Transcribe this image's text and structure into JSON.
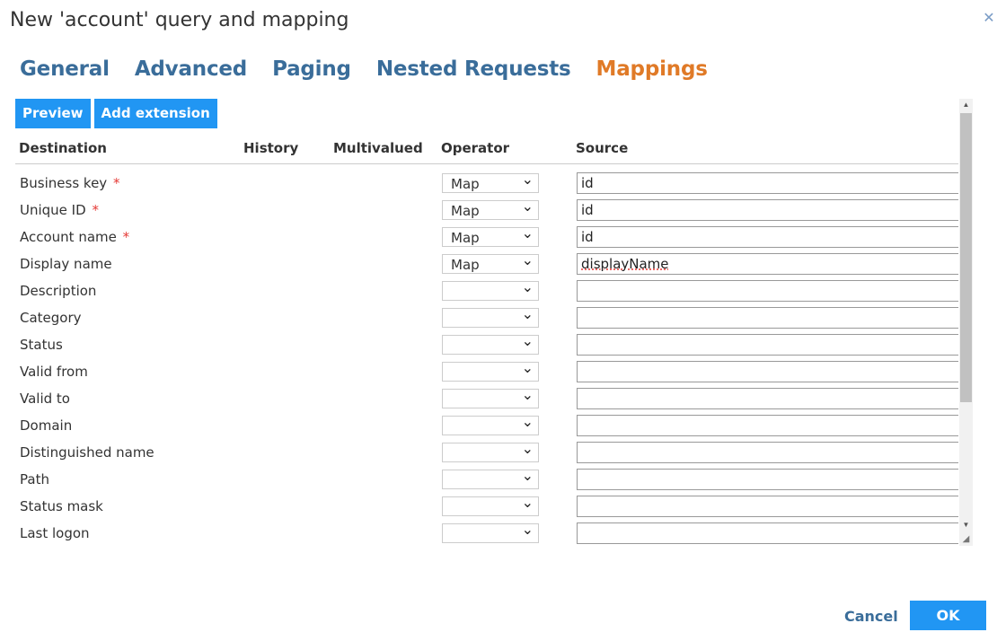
{
  "dialog": {
    "title": "New 'account' query and mapping",
    "close_icon": "close-icon"
  },
  "tabs": [
    {
      "label": "General",
      "active": false
    },
    {
      "label": "Advanced",
      "active": false
    },
    {
      "label": "Paging",
      "active": false
    },
    {
      "label": "Nested Requests",
      "active": false
    },
    {
      "label": "Mappings",
      "active": true
    }
  ],
  "toolbar": {
    "preview_label": "Preview",
    "add_extension_label": "Add extension"
  },
  "columns": {
    "destination": "Destination",
    "history": "History",
    "multivalued": "Multivalued",
    "operator": "Operator",
    "source": "Source"
  },
  "rows": [
    {
      "label": "Business key",
      "required": "*",
      "operator": "Map",
      "source": "id"
    },
    {
      "label": "Unique ID",
      "required": "*",
      "operator": "Map",
      "source": "id"
    },
    {
      "label": "Account name",
      "required": "*",
      "operator": "Map",
      "source": "id"
    },
    {
      "label": "Display name",
      "required": "",
      "operator": "Map",
      "source": "displayName"
    },
    {
      "label": "Description",
      "required": "",
      "operator": "",
      "source": ""
    },
    {
      "label": "Category",
      "required": "",
      "operator": "",
      "source": ""
    },
    {
      "label": "Status",
      "required": "",
      "operator": "",
      "source": ""
    },
    {
      "label": "Valid from",
      "required": "",
      "operator": "",
      "source": ""
    },
    {
      "label": "Valid to",
      "required": "",
      "operator": "",
      "source": ""
    },
    {
      "label": "Domain",
      "required": "",
      "operator": "",
      "source": ""
    },
    {
      "label": "Distinguished name",
      "required": "",
      "operator": "",
      "source": ""
    },
    {
      "label": "Path",
      "required": "",
      "operator": "",
      "source": ""
    },
    {
      "label": "Status mask",
      "required": "",
      "operator": "",
      "source": ""
    },
    {
      "label": "Last logon",
      "required": "",
      "operator": "",
      "source": ""
    }
  ],
  "footer": {
    "cancel_label": "Cancel",
    "ok_label": "OK"
  },
  "colors": {
    "tab": "#3a6d9a",
    "tab_active": "#e07a27",
    "button": "#2196f3",
    "required": "#e53935"
  }
}
